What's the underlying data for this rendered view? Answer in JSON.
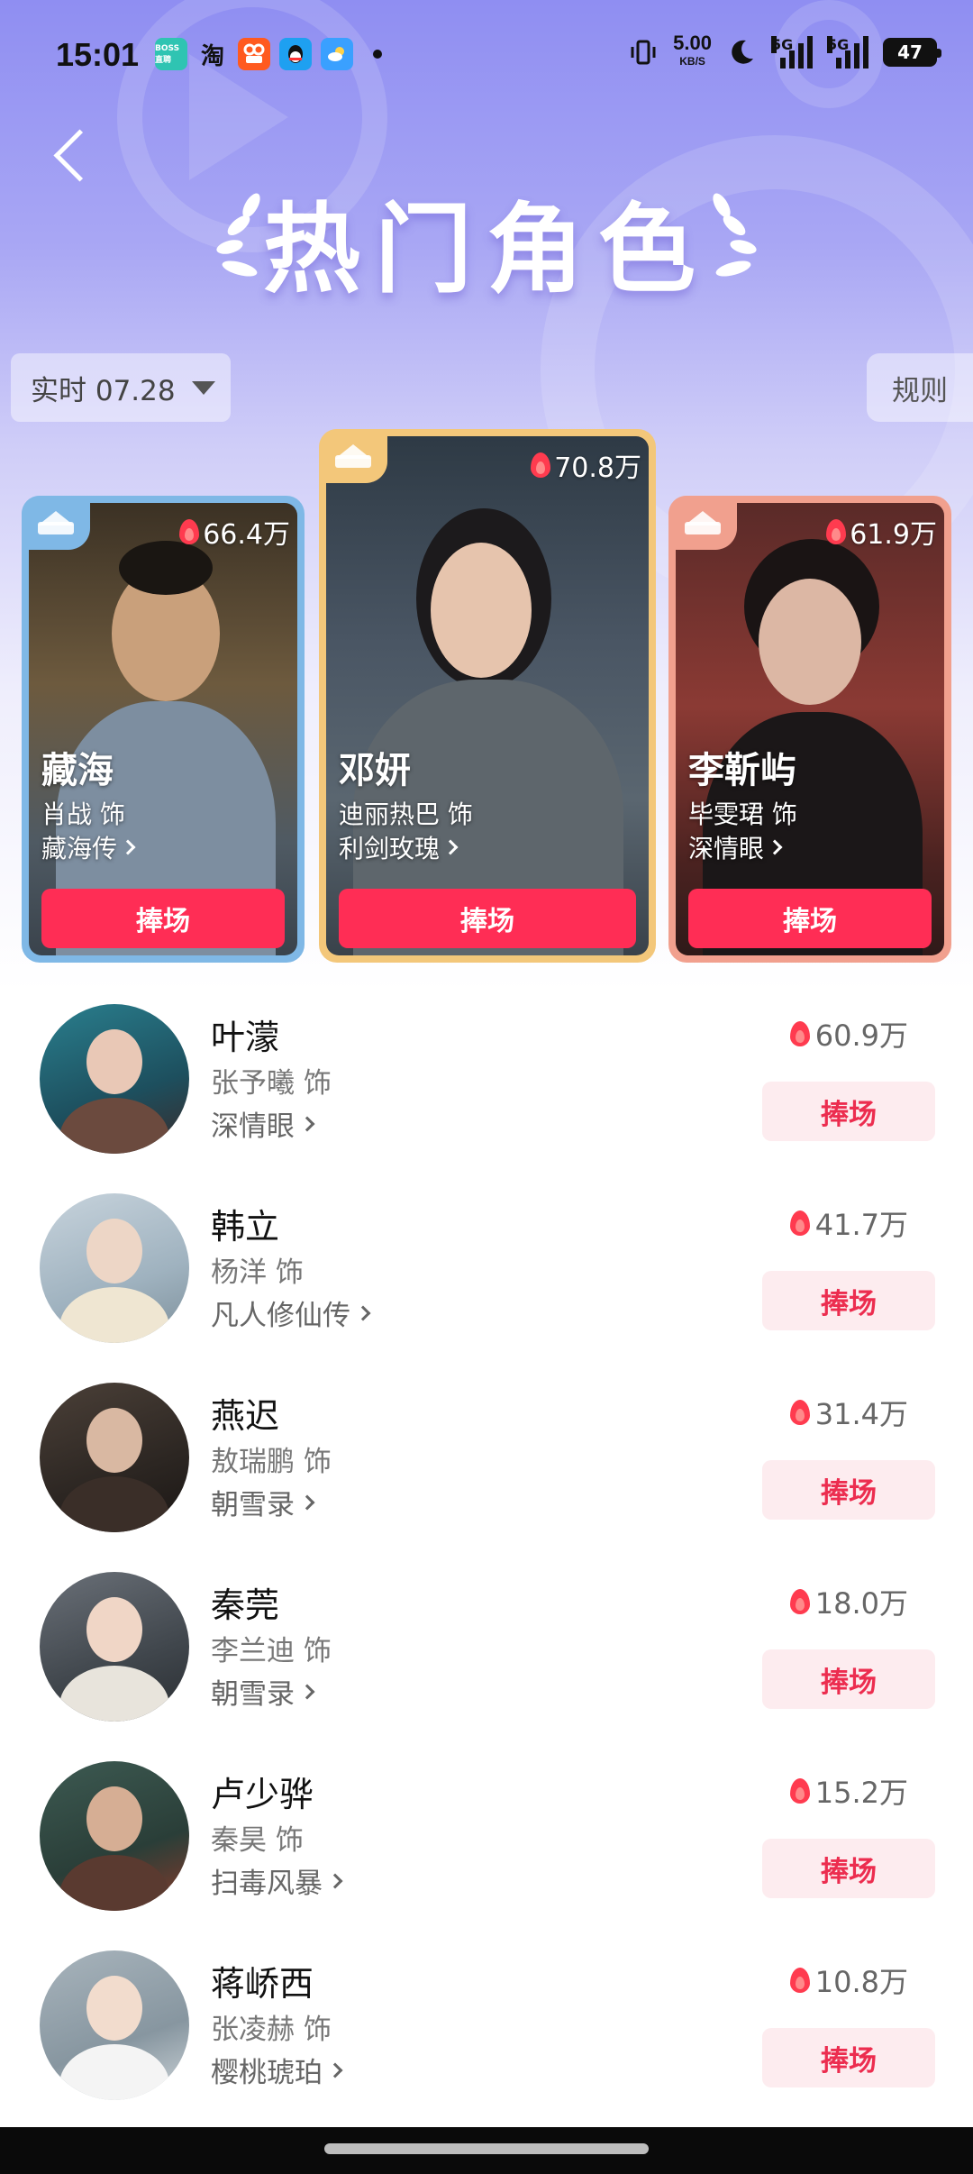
{
  "status_bar": {
    "time": "15:01",
    "app_icons": [
      {
        "name": "boss-zhipin-icon",
        "label": "BOSS直聘",
        "color": "#2fc4b2"
      },
      {
        "name": "taobao-icon",
        "label": "淘",
        "color": "#ffffff"
      },
      {
        "name": "kuaishou-icon",
        "label": "",
        "color": "#ff5a1f"
      },
      {
        "name": "qq-icon",
        "label": "",
        "color": "#1ea0f1"
      },
      {
        "name": "weather-icon",
        "label": "",
        "color": "#3aa0ff"
      }
    ],
    "net_speed": "5.00",
    "net_unit": "KB/S",
    "signal_1": "5G",
    "signal_2": "5G",
    "battery": "47"
  },
  "header": {
    "title": "热门角色",
    "back_icon": "back-arrow-icon"
  },
  "filters": {
    "date_label": "实时 07.28",
    "rules_label": "规则"
  },
  "colors": {
    "accent": "#ff2d55",
    "cheer_light_bg": "#fdecef",
    "rank1_border": "#f3c77a",
    "rank2_border": "#7fb8e6",
    "rank3_border": "#f1a08e"
  },
  "podium": [
    {
      "rank": 2,
      "name": "藏海",
      "actor": "肖战 饰",
      "show": "藏海传",
      "heat": "66.4万",
      "cheer": "捧场"
    },
    {
      "rank": 1,
      "name": "邓妍",
      "actor": "迪丽热巴 饰",
      "show": "利剑玫瑰",
      "heat": "70.8万",
      "cheer": "捧场"
    },
    {
      "rank": 3,
      "name": "李靳屿",
      "actor": "毕雯珺 饰",
      "show": "深情眼",
      "heat": "61.9万",
      "cheer": "捧场"
    }
  ],
  "list": [
    {
      "name": "叶濛",
      "actor": "张予曦 饰",
      "show": "深情眼",
      "heat": "60.9万",
      "cheer": "捧场"
    },
    {
      "name": "韩立",
      "actor": "杨洋 饰",
      "show": "凡人修仙传",
      "heat": "41.7万",
      "cheer": "捧场"
    },
    {
      "name": "燕迟",
      "actor": "敖瑞鹏 饰",
      "show": "朝雪录",
      "heat": "31.4万",
      "cheer": "捧场"
    },
    {
      "name": "秦莞",
      "actor": "李兰迪 饰",
      "show": "朝雪录",
      "heat": "18.0万",
      "cheer": "捧场"
    },
    {
      "name": "卢少骅",
      "actor": "秦昊 饰",
      "show": "扫毒风暴",
      "heat": "15.2万",
      "cheer": "捧场"
    },
    {
      "name": "蒋峤西",
      "actor": "张凌赫 饰",
      "show": "樱桃琥珀",
      "heat": "10.8万",
      "cheer": "捧场"
    }
  ]
}
